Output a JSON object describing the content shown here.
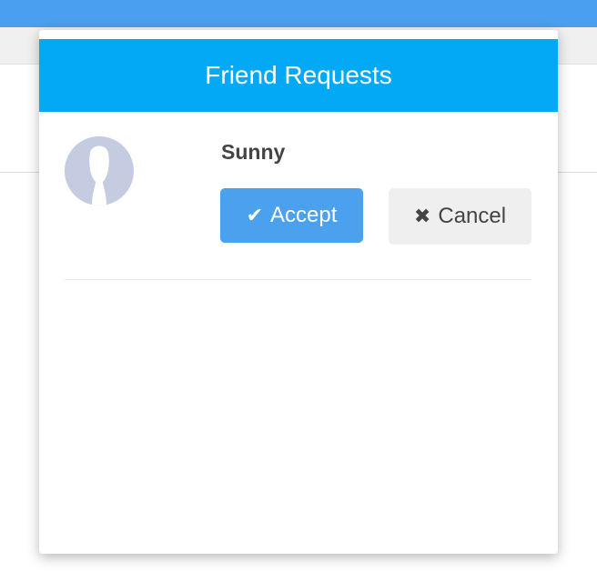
{
  "popup": {
    "title": "Friend Requests",
    "requests": [
      {
        "name": "Sunny",
        "accept_label": "Accept",
        "cancel_label": "Cancel",
        "accept_icon": "check-icon",
        "cancel_icon": "close-icon"
      }
    ]
  },
  "colors": {
    "topbar": "#4a9ff0",
    "header": "#03a9f4",
    "accept": "#4ba1ee",
    "cancel": "#efefef",
    "avatar": "#c5cbe0"
  }
}
